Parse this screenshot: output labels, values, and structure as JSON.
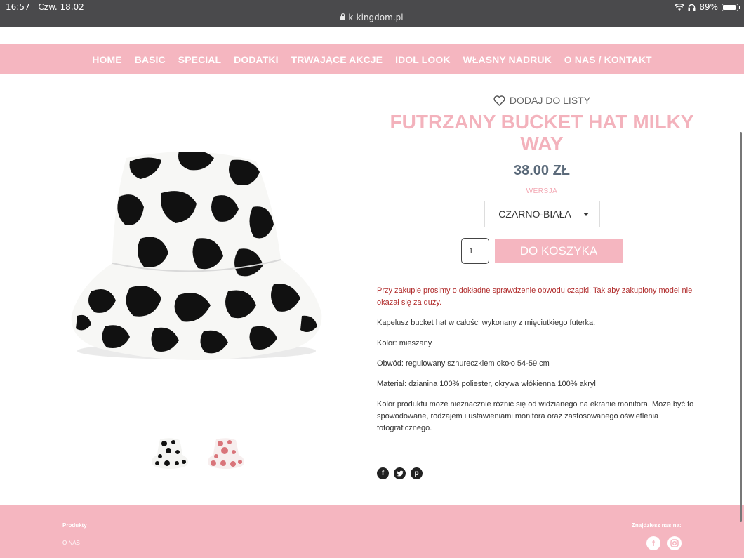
{
  "status_bar": {
    "time": "16:57",
    "date": "Czw. 18.02",
    "battery": "89%",
    "battery_level": 0.89,
    "url": "k-kingdom.pl"
  },
  "nav": {
    "items": [
      "HOME",
      "BASIC",
      "SPECIAL",
      "DODATKI",
      "TRWAJĄCE AKCJE",
      "IDOL LOOK",
      "WŁASNY NADRUK",
      "O NAS / KONTAKT"
    ]
  },
  "product": {
    "wishlist_label": "DODAJ DO LISTY",
    "title": "FUTRZANY BUCKET HAT MILKY WAY",
    "price": "38.00 ZŁ",
    "variant_label": "WERSJA",
    "variant_selected": "CZARNO-BIAŁA",
    "quantity": "1",
    "add_to_cart": "DO KOSZYKA",
    "description": [
      "Przy zakupie prosimy o dokładne sprawdzenie obwodu czapki! Tak aby zakupiony model nie okazał się za duży.",
      "Kapelusz bucket hat w całości wykonany z mięciutkiego futerka.",
      "Kolor: mieszany",
      "Obwód: regulowany sznureczkiem około 54-59 cm",
      "Materiał: dzianina 100% poliester, okrywa włókienna 100% akryl",
      "Kolor produktu może nieznacznie różnić się od widzianego na ekranie monitora. Może być to spowodowane, rodzajem i ustawieniami monitora oraz zastosowanego oświetlenia fotograficznego."
    ]
  },
  "social_share": [
    "facebook-icon",
    "twitter-icon",
    "pinterest-icon"
  ],
  "footer": {
    "products": "Produkty",
    "about": "O NAS",
    "find_us": "Znajdziesz nas na:"
  },
  "colors": {
    "brand_pink": "#f5b6c0",
    "title_pink": "#f3b2bc",
    "price": "#5b6a7a",
    "warning": "#b02a2a"
  }
}
